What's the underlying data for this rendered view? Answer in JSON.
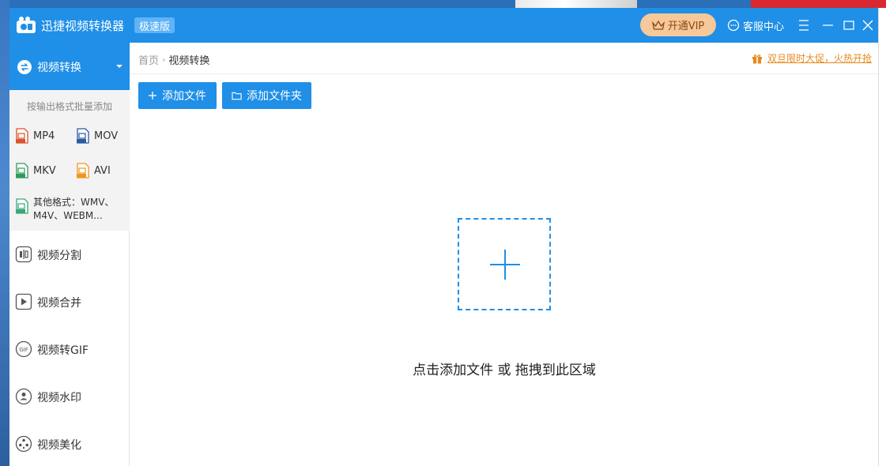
{
  "titlebar": {
    "app_name": "迅捷视频转换器",
    "edition": "极速版",
    "vip_label": "开通VIP",
    "support_label": "客服中心"
  },
  "sidebar": {
    "active_item": {
      "label": "视频转换"
    },
    "sub_title": "按输出格式批量添加",
    "formats": [
      {
        "label": "MP4",
        "color": "#d9532c"
      },
      {
        "label": "MOV",
        "color": "#2c5aa0"
      },
      {
        "label": "MKV",
        "color": "#2f9a5a"
      },
      {
        "label": "AVI",
        "color": "#f0961e"
      }
    ],
    "other_formats": {
      "line1": "其他格式：WMV、",
      "line2": "M4V、WEBM..."
    },
    "items": [
      {
        "label": "视频分割",
        "icon": "split-icon"
      },
      {
        "label": "视频合并",
        "icon": "merge-icon"
      },
      {
        "label": "视频转GIF",
        "icon": "gif-icon"
      },
      {
        "label": "视频水印",
        "icon": "watermark-icon"
      },
      {
        "label": "视频美化",
        "icon": "beautify-icon"
      }
    ]
  },
  "main": {
    "breadcrumb": {
      "home": "首页",
      "current": "视频转换"
    },
    "promo": "双旦限时大促，火热开抢",
    "add_file_label": "添加文件",
    "add_folder_label": "添加文件夹",
    "drop_hint": "点击添加文件 或 拖拽到此区域"
  },
  "colors": {
    "accent": "#1f8fe7",
    "vip": "#f6c89a",
    "promo": "#e58a1f"
  }
}
